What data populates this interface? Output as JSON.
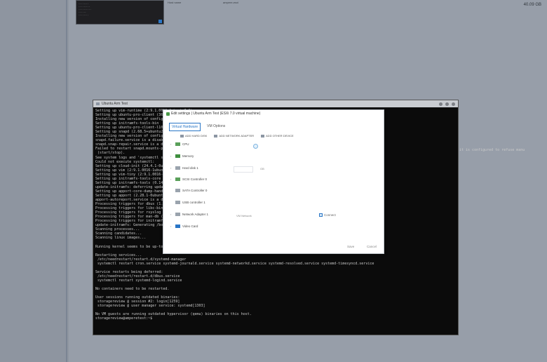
{
  "background": {
    "host_label": "Host name",
    "host_value": "ampere-esxi",
    "capacity": "40.09 GB"
  },
  "console": {
    "title": "Ubuntu Arm Test",
    "right_fragment": "it is configured to refuse manu",
    "lines": [
      "Setting up vim-runtime (2:9.1.0016-1ubuntu7.8) ...",
      "Setting up ubuntu-pro-client (36ubuntu0~24.04) ...",
      "Installing new version of config",
      "Setting up initramfs-tools-bin",
      "Setting up ubuntu-pro-client-l10n",
      "Setting up snapd (2.68.5+ubuntu24",
      "Installing new version of config",
      "snapd.failure.service is a disab",
      "snapd.snap-repair.service is a d",
      "Failed to restart snapd.mounts-p",
      " (start/stop).",
      "See system logs and 'systemctl s",
      "Could not execute systemctl:",
      "Setting up cloud-init (24.4.1-0u",
      "Setting up vim (2:9.1.0016-1ubun",
      "Setting up vim-tiny (2:9.1.0016-",
      "Setting up initramfs-tools-core",
      "Setting up initramfs-tools (0.14",
      "update-initramfs: deferring upda",
      "Setting up apport-core-dump-hand",
      "Setting up apport (2.28.1-0ubunt",
      "apport-autoreport.service is a d",
      "Processing triggers for dbus (1.",
      "Processing triggers for libc-bin",
      "Processing triggers for rsyslog",
      "Processing triggers for man-db (",
      "Processing triggers for initramf",
      "update-initramfs: Generating /bo",
      "Scanning processes...",
      "Scanning candidates...",
      "Scanning linux images...",
      "",
      "Running kernel seems to be up-to-date.",
      "",
      "Restarting services...",
      " /etc/needrestart/restart.d/systemd-manager",
      " systemctl restart cron.service systemd-journald.service systemd-networkd.service systemd-resolved.service systemd-timesyncd.service",
      "",
      "Service restarts being deferred:",
      " /etc/needrestart/restart.d/dbus.service",
      " systemctl restart systemd-logind.service",
      "",
      "No containers need to be restarted.",
      "",
      "User sessions running outdated binaries:",
      " storagereview @ session #2: login[1259]",
      " storagereview @ user manager service: systemd[1303]",
      "",
      "No VM guests are running outdated hypervisor (qemu) binaries on this host.",
      "storagereview@amperetest:~$"
    ]
  },
  "dialog": {
    "title": "Edit settings | Ubuntu Arm Test (ESXi 7.0 virtual machine)",
    "tabs": [
      "Virtual Hardware",
      "VM Options"
    ],
    "toolbar": {
      "add_hard_disk": "ADD HARD DISK",
      "add_network_adapter": "ADD NETWORK ADAPTER",
      "add_other_device": "ADD OTHER DEVICE"
    },
    "hardware": {
      "cpu": "CPU",
      "memory": "Memory",
      "hard_disk": "Hard disk 1",
      "hard_disk_unit": "GB",
      "scsi": "SCSI Controller 0",
      "sata": "SATA Controller 0",
      "usb": "USB controller 1",
      "network": "Network Adapter 1",
      "network_value": "VM Network",
      "connect": "Connect",
      "video": "Video Card"
    },
    "save": "Save",
    "cancel": "Cancel"
  },
  "colors": {
    "accent": "#2a76c6",
    "terminal_bg": "#0b0b0b",
    "terminal_text": "#c9c9c9"
  }
}
